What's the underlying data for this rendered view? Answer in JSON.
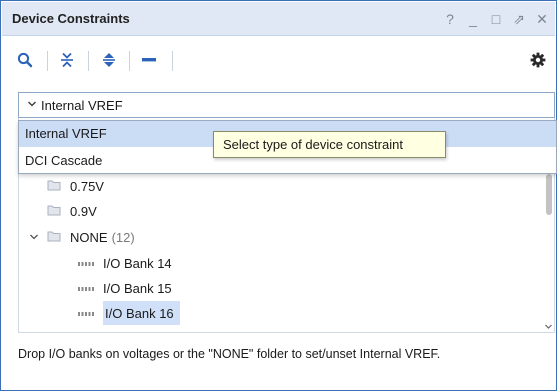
{
  "panel": {
    "title": "Device Constraints",
    "window_controls": {
      "help": "?",
      "minimize": "_",
      "restore": "□",
      "float": "⇗",
      "close": "✕"
    }
  },
  "toolbar": {
    "items": [
      "search-icon",
      "collapse-all-icon",
      "expand-all-icon",
      "remove-icon"
    ],
    "settings": "gear-icon"
  },
  "combo": {
    "selected": "Internal VREF"
  },
  "dropdown": {
    "options": [
      "Internal VREF",
      "DCI Cascade"
    ],
    "highlighted_index": 0
  },
  "tooltip": {
    "text": "Select type of device constraint"
  },
  "tree": {
    "items": [
      {
        "label": "0.75V",
        "type": "folder"
      },
      {
        "label": "0.9V",
        "type": "folder"
      },
      {
        "label": "NONE",
        "count": "(12)",
        "type": "folder",
        "expanded": true
      },
      {
        "label": "I/O Bank 14",
        "type": "bank"
      },
      {
        "label": "I/O Bank 15",
        "type": "bank"
      },
      {
        "label": "I/O Bank 16",
        "type": "bank",
        "selected": true
      }
    ]
  },
  "status": {
    "text": "Drop I/O banks on voltages or the \"NONE\" folder to set/unset Internal VREF."
  },
  "colors": {
    "accent": "#2a63b8",
    "title_bg": "#dfe8f4",
    "selection": "#cfe0f8",
    "tooltip_bg": "#ffffe1"
  }
}
